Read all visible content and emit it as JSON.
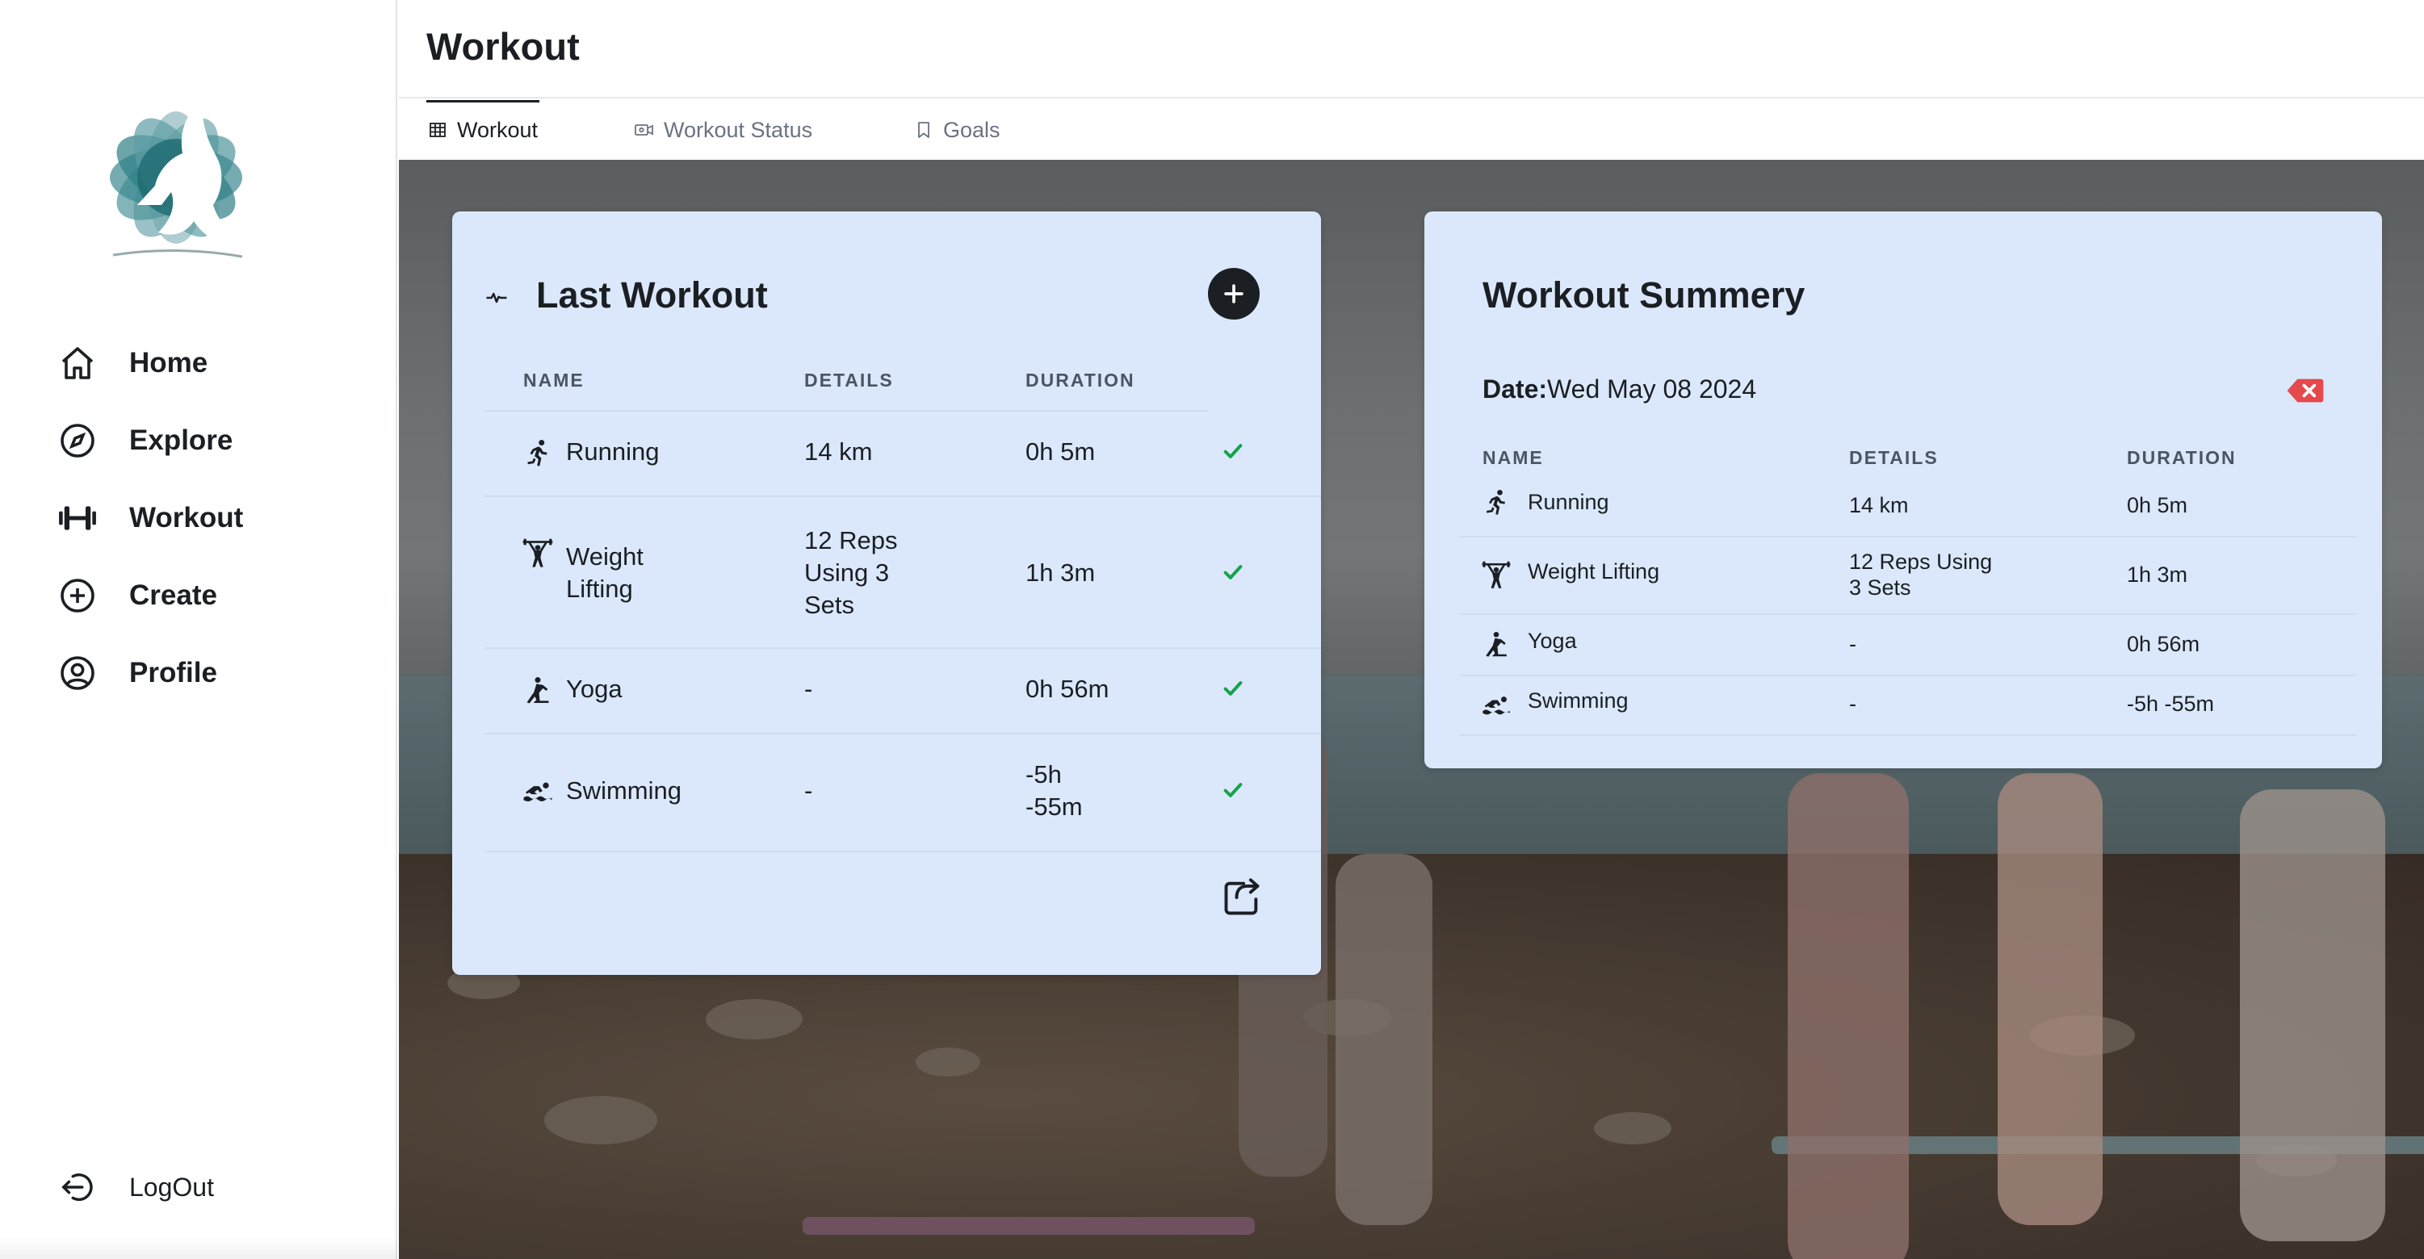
{
  "sidebar": {
    "items": [
      {
        "label": "Home",
        "icon": "home-icon"
      },
      {
        "label": "Explore",
        "icon": "compass-icon"
      },
      {
        "label": "Workout",
        "icon": "dumbbell-icon"
      },
      {
        "label": "Create",
        "icon": "plus-circle-icon"
      },
      {
        "label": "Profile",
        "icon": "user-circle-icon"
      }
    ],
    "logout_label": "LogOut"
  },
  "header": {
    "title": "Workout"
  },
  "tabs": [
    {
      "label": "Workout",
      "icon": "table-icon",
      "active": true
    },
    {
      "label": "Workout Status",
      "icon": "video-icon",
      "active": false
    },
    {
      "label": "Goals",
      "icon": "bookmark-icon",
      "active": false
    }
  ],
  "last_workout": {
    "title": "Last Workout",
    "columns": [
      "NAME",
      "DETAILS",
      "DURATION"
    ],
    "rows": [
      {
        "name": "Running",
        "details": "14 km",
        "duration": "0h 5m",
        "icon": "running-icon"
      },
      {
        "name": "Weight Lifting",
        "details": "12 Reps Using 3 Sets",
        "duration": "1h 3m",
        "icon": "weightlifting-icon"
      },
      {
        "name": "Yoga",
        "details": "-",
        "duration": "0h 56m",
        "icon": "yoga-icon"
      },
      {
        "name": "Swimming",
        "details": "-",
        "duration": "-5h -55m",
        "icon": "swimming-icon"
      }
    ]
  },
  "summary": {
    "title": "Workout Summery",
    "date_label": "Date:",
    "date_value": "Wed May 08 2024",
    "columns": [
      "NAME",
      "DETAILS",
      "DURATION"
    ],
    "rows": [
      {
        "name": "Running",
        "details": "14 km",
        "duration": "0h 5m",
        "icon": "running-icon"
      },
      {
        "name": "Weight Lifting",
        "details": "12 Reps Using 3 Sets",
        "duration": "1h 3m",
        "icon": "weightlifting-icon"
      },
      {
        "name": "Yoga",
        "details": "-",
        "duration": "0h 56m",
        "icon": "yoga-icon"
      },
      {
        "name": "Swimming",
        "details": "-",
        "duration": "-5h -55m",
        "icon": "swimming-icon"
      }
    ]
  },
  "colors": {
    "card_bg": "#dbe8fb",
    "check_green": "#16a34a",
    "delete_red": "#e5484d",
    "logo_teal": "#2f7f86"
  }
}
